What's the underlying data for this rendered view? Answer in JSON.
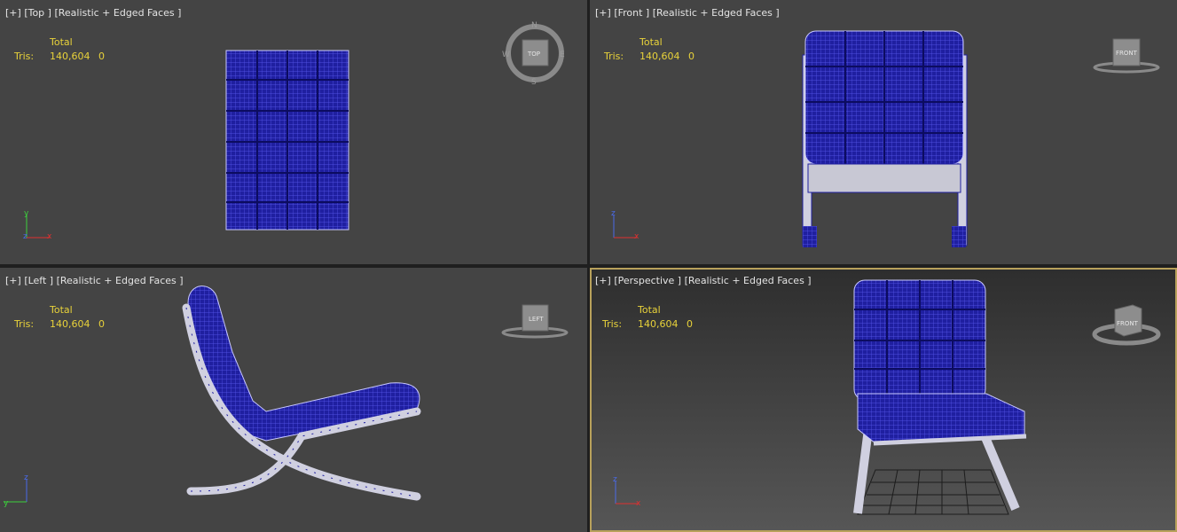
{
  "viewports": [
    {
      "id": "top",
      "menu": "[+]",
      "view": "[Top ]",
      "shading": "[Realistic + Edged Faces ]",
      "cube_label": "TOP",
      "compass": [
        "N",
        "E",
        "S",
        "W"
      ],
      "axes": [
        "y",
        "z",
        "x"
      ]
    },
    {
      "id": "front",
      "menu": "[+]",
      "view": "[Front ]",
      "shading": "[Realistic + Edged Faces ]",
      "cube_label": "FRONT",
      "axes": [
        "z",
        "x"
      ]
    },
    {
      "id": "left",
      "menu": "[+]",
      "view": "[Left ]",
      "shading": "[Realistic + Edged Faces ]",
      "cube_label": "LEFT",
      "axes": [
        "z",
        "y"
      ]
    },
    {
      "id": "perspective",
      "menu": "[+]",
      "view": "[Perspective ]",
      "shading": "[Realistic + Edged Faces ]",
      "cube_label": "FRONT",
      "axes": [
        "z",
        "x"
      ]
    }
  ],
  "stats": {
    "total_label": "Total",
    "tris_label": "Tris:",
    "tris_value": "140,604",
    "tris_selected": "0"
  },
  "colors": {
    "mesh": "#1f1fa0",
    "wire": "#5a5af0",
    "frame": "#d8d8e8",
    "active_border": "#b8a15b",
    "stats_text": "#e8d23a"
  }
}
